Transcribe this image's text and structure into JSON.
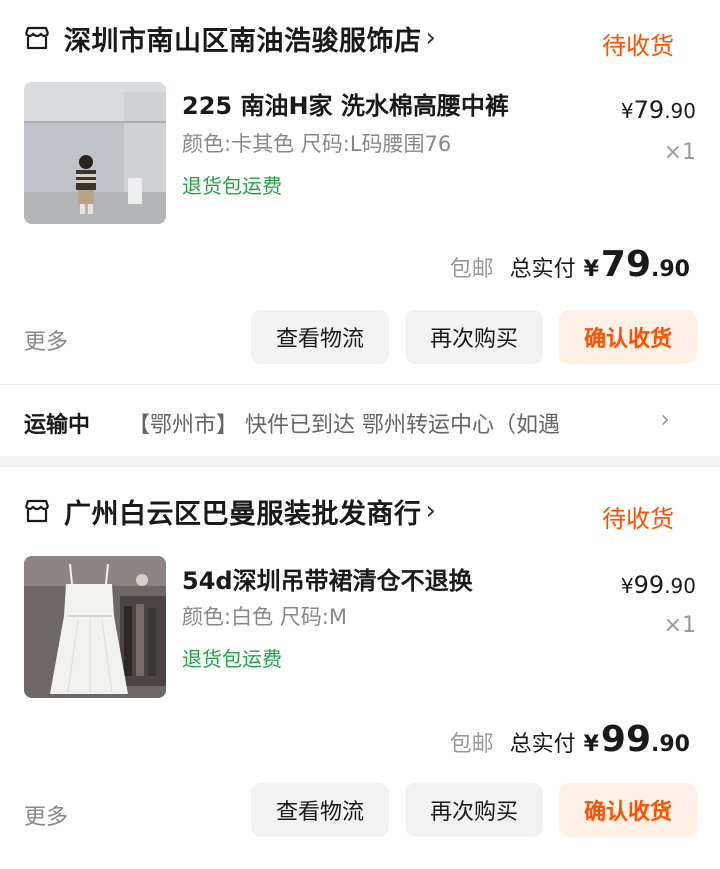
{
  "orders": [
    {
      "shop_name": "深圳市南山区南油浩骏服饰店",
      "status": "待收货",
      "product_title": "225 南油H家 洗水棉高腰中裤",
      "spec": "颜色:卡其色 尺码:L码腰围76",
      "refund_tag": "退货包运费",
      "unit_price_yen": "¥",
      "unit_price_int": "79",
      "unit_price_dec": ".90",
      "quantity": "×1",
      "free_shipping": "包邮",
      "total_label": "总实付",
      "total_yen": "¥",
      "total_int": "79",
      "total_dec": ".90",
      "more_label": "更多",
      "btn_logistics": "查看物流",
      "btn_rebuy": "再次购买",
      "btn_confirm": "确认收货"
    },
    {
      "shop_name": "广州白云区巴曼服装批发商行",
      "status": "待收货",
      "product_title": "54d深圳吊带裙清仓不退换",
      "spec": "颜色:白色 尺码:M",
      "refund_tag": "退货包运费",
      "unit_price_yen": "¥",
      "unit_price_int": "99",
      "unit_price_dec": ".90",
      "quantity": "×1",
      "free_shipping": "包邮",
      "total_label": "总实付",
      "total_yen": "¥",
      "total_int": "99",
      "total_dec": ".90",
      "more_label": "更多",
      "btn_logistics": "查看物流",
      "btn_rebuy": "再次购买",
      "btn_confirm": "确认收货"
    }
  ],
  "logistics": {
    "status": "运输中",
    "text": "【鄂州市】 快件已到达 鄂州转运中心（如遇"
  },
  "colors": {
    "accent": "#ff5000",
    "refund_green": "#24a148",
    "confirm_bg": "#fff1e6"
  }
}
